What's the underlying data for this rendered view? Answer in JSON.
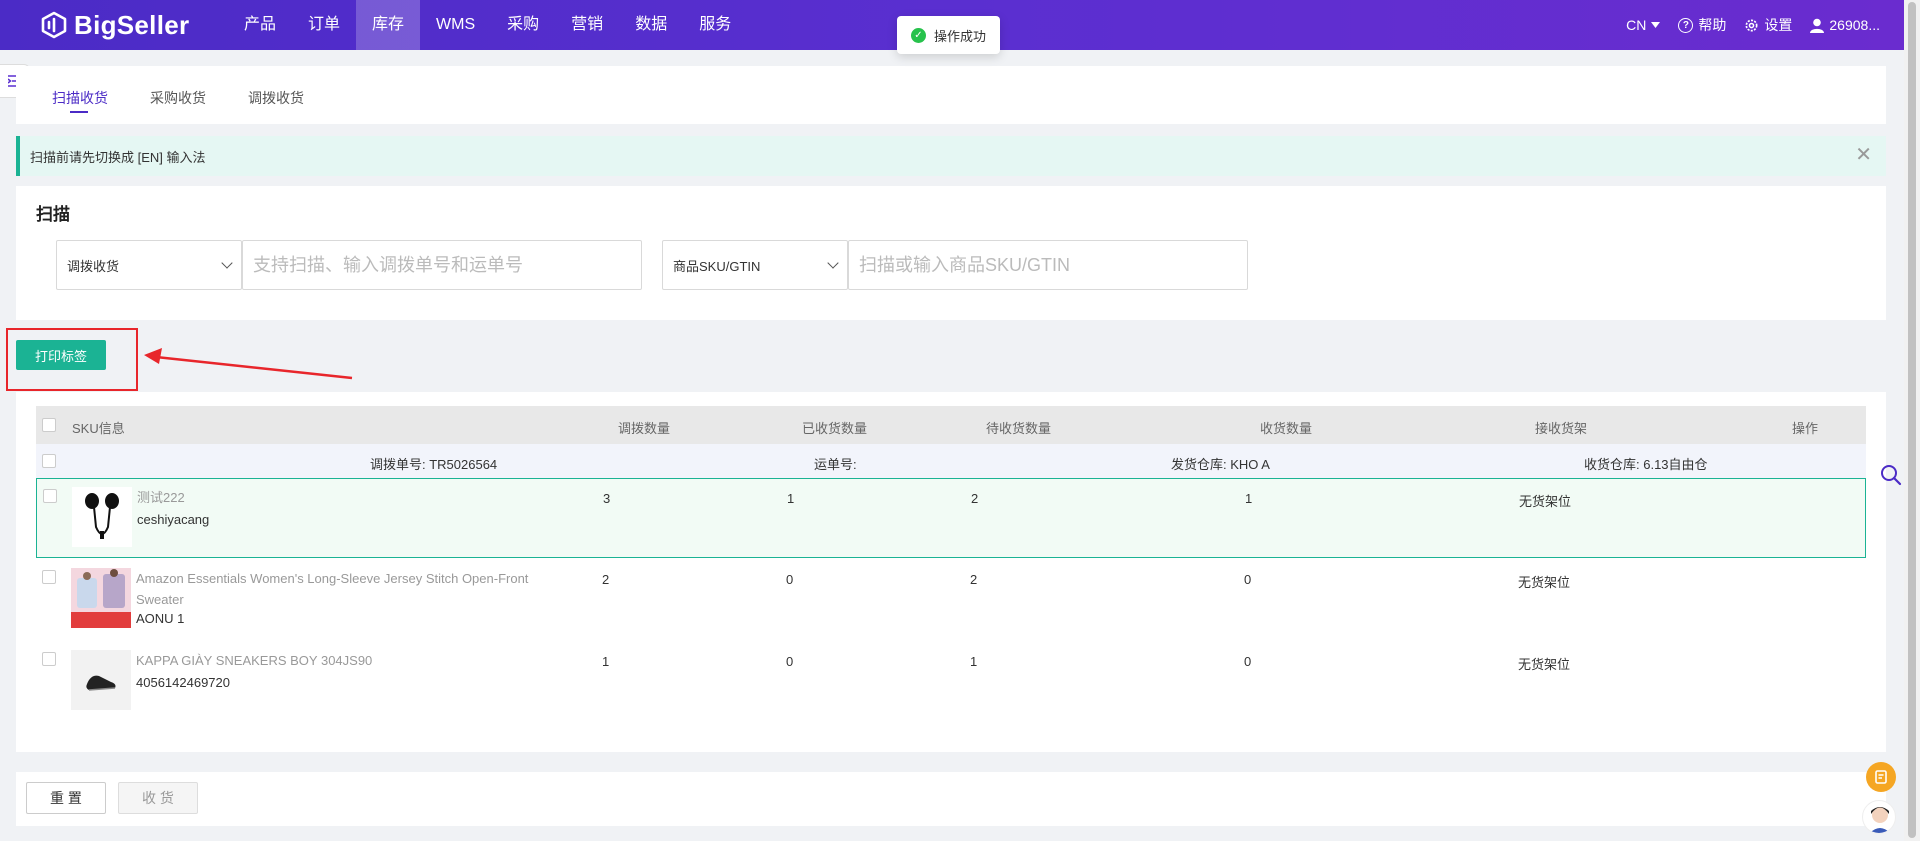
{
  "header": {
    "brand": "BigSeller",
    "nav": [
      "产品",
      "订单",
      "库存",
      "WMS",
      "采购",
      "营销",
      "数据",
      "服务"
    ],
    "active_nav_index": 2,
    "lang": "CN",
    "help": "帮助",
    "settings": "设置",
    "user": "26908..."
  },
  "toast": {
    "text": "操作成功"
  },
  "tabs": [
    "扫描收货",
    "采购收货",
    "调拨收货"
  ],
  "alert": {
    "text": "扫描前请先切换成 [EN] 输入法"
  },
  "scan": {
    "title": "扫描",
    "type_select": "调拨收货",
    "order_placeholder": "支持扫描、输入调拨单号和运单号",
    "sku_select": "商品SKU/GTIN",
    "sku_placeholder": "扫描或输入商品SKU/GTIN"
  },
  "print_label_button": "打印标签",
  "table": {
    "columns": [
      "SKU信息",
      "调拨数量",
      "已收货数量",
      "待收货数量",
      "收货数量",
      "接收货架",
      "操作"
    ],
    "group": {
      "transfer_no": "调拨单号: TR5026564",
      "tracking_no": "运单号:",
      "from_warehouse": "发货仓库: KHO A",
      "to_warehouse": "收货仓库: 6.13自由仓"
    },
    "rows": [
      {
        "name": "测试222",
        "sku": "ceshiyacang",
        "transfer_qty": "3",
        "received_qty": "1",
        "pending_qty": "2",
        "receive_qty": "1",
        "shelf": "无货架位",
        "image": "earphones"
      },
      {
        "name": "Amazon Essentials Women's Long-Sleeve Jersey Stitch Open-Front Sweater",
        "sku": "AONU 1",
        "transfer_qty": "2",
        "received_qty": "0",
        "pending_qty": "2",
        "receive_qty": "0",
        "shelf": "无货架位",
        "image": "sweater"
      },
      {
        "name": "KAPPA GIÀY SNEAKERS BOY 304JS90",
        "sku": "4056142469720",
        "transfer_qty": "1",
        "received_qty": "0",
        "pending_qty": "1",
        "receive_qty": "0",
        "shelf": "无货架位",
        "image": "sneaker"
      }
    ]
  },
  "footer": {
    "reset": "重 置",
    "receive": "收 货"
  },
  "colors": {
    "brand": "#4b2bc6",
    "primary_green": "#1bb394",
    "alert_red": "#e8262b"
  }
}
